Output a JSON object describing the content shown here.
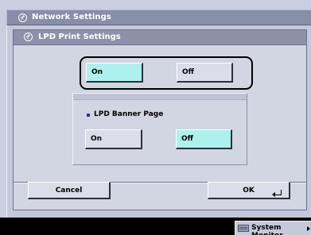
{
  "window": {
    "title": "Network Settings"
  },
  "dialog": {
    "title": "LPD Print Settings",
    "top_toggle": {
      "on_label": "On",
      "off_label": "Off",
      "selected": "On"
    },
    "banner_page": {
      "label": "LPD Banner Page",
      "on_label": "On",
      "off_label": "Off",
      "selected": "Off"
    },
    "cancel_label": "Cancel",
    "ok_label": "OK"
  },
  "status_bar": {
    "system_monitor_label": "System Monitor"
  },
  "colors": {
    "selected": "#aef0ec",
    "title_bar": "#878ea8",
    "background": "#c9cfe0",
    "bullet": "#1e35a6"
  }
}
